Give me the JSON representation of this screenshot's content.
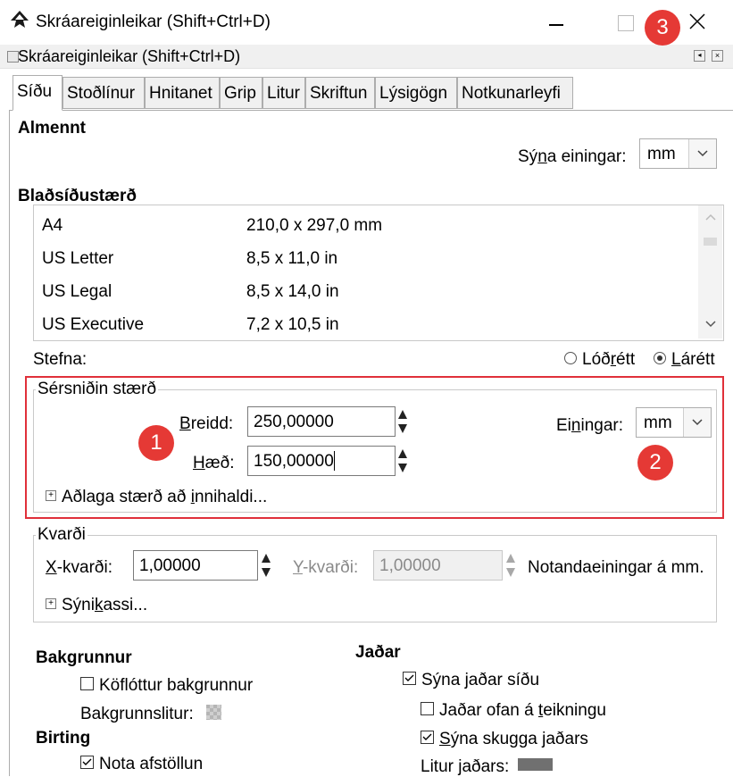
{
  "window": {
    "title": "Skráareiginleikar (Shift+Ctrl+D)",
    "minimize_icon": "minimize-icon",
    "maximize_icon": "maximize-icon",
    "close_icon": "close-icon"
  },
  "dock": {
    "title": "Skráareiginleikar (Shift+Ctrl+D)"
  },
  "tabs": [
    "Síðu",
    "Stoðlínur",
    "Hnitanet",
    "Grip",
    "Litur",
    "Skriftun",
    "Lýsigögn",
    "Notkunarleyfi"
  ],
  "general": {
    "heading": "Almennt",
    "units_label_pre": "Sý",
    "units_label_u": "n",
    "units_label_post": "a einingar:",
    "units_value": "mm"
  },
  "page_size": {
    "heading": "Blaðsíðustærð",
    "rows": [
      {
        "name": "A4",
        "size": "210,0 x 297,0 mm"
      },
      {
        "name": "US Letter",
        "size": "8,5 x 11,0 in"
      },
      {
        "name": "US Legal",
        "size": "8,5 x 14,0 in"
      },
      {
        "name": "US Executive",
        "size": "7,2 x 10,5 in"
      }
    ]
  },
  "orientation": {
    "label": "Stefna:",
    "portrait_pre": "Lóð",
    "portrait_u": "r",
    "portrait_post": "étt",
    "landscape_u": "L",
    "landscape_post": "árétt"
  },
  "custom_size": {
    "title": "Sérsniðin stærð",
    "width_u": "B",
    "width_post": "reidd:",
    "width_value": "250,00000",
    "height_u": "H",
    "height_post": "æð:",
    "height_value": "150,00000",
    "units_pre": "Ei",
    "units_u": "n",
    "units_post": "ingar:",
    "units_value": "mm",
    "resize_pre": "Aðlaga stærð að ",
    "resize_u": "i",
    "resize_post": "nnihaldi..."
  },
  "scale": {
    "title": "Kvarði",
    "x_u": "X",
    "x_post": "-kvarði:",
    "x_value": "1,00000",
    "y_u": "Y",
    "y_post": "-kvarði:",
    "y_value": "1,00000",
    "user_units": "Notandaeiningar á mm.",
    "viewbox_pre": "Sýni",
    "viewbox_u": "k",
    "viewbox_post": "assi..."
  },
  "background": {
    "heading": "Bakgrunnur",
    "checkerboard": "Köflóttur bakgrunnur",
    "color_label": "Bakgrunnslitur:"
  },
  "display": {
    "heading": "Birting",
    "antialias": "Nota afstöllun"
  },
  "border": {
    "heading": "Jaðar",
    "show_border": "Sýna jaðar síðu",
    "border_on_top_pre": "Jaðar ofan á ",
    "border_on_top_u": "t",
    "border_on_top_post": "eikningu",
    "show_shadow_u": "S",
    "show_shadow_post": "ýna skugga jaðars",
    "border_color": "Litur jaðars:"
  },
  "markers": [
    "1",
    "2",
    "3"
  ],
  "colors": {
    "marker": "#e53935",
    "highlight": "#e0303a",
    "border_swatch": "#707070",
    "bg_swatch": "#c8c8c8"
  }
}
